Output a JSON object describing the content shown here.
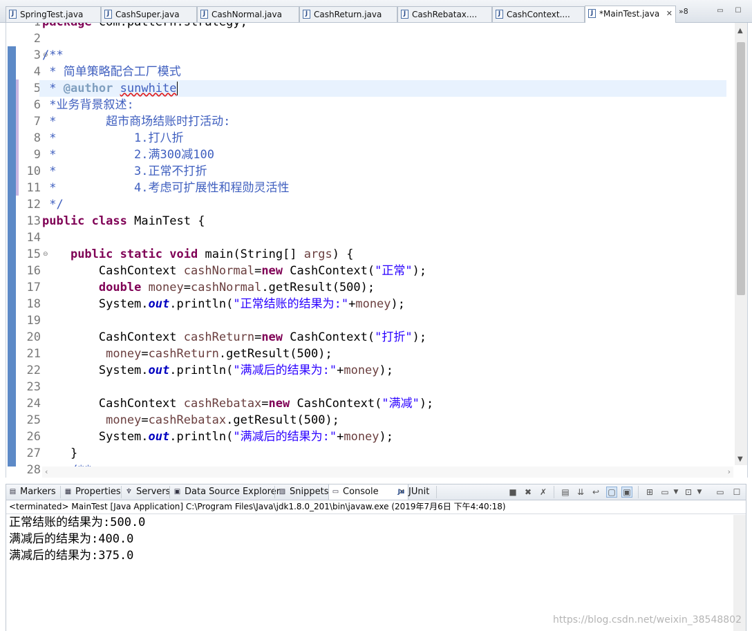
{
  "editor_tabs": [
    {
      "label": "SpringTest.java",
      "active": false
    },
    {
      "label": "CashSuper.java",
      "active": false
    },
    {
      "label": "CashNormal.java",
      "active": false
    },
    {
      "label": "CashReturn.java",
      "active": false
    },
    {
      "label": "CashRebatax....",
      "active": false
    },
    {
      "label": "CashContext....",
      "active": false
    },
    {
      "label": "*MainTest.java",
      "active": true
    }
  ],
  "overflow_tabs": "»8",
  "code_lines": [
    {
      "n": "1",
      "t": "package com.pattern.strategy;"
    },
    {
      "n": "2",
      "t": ""
    },
    {
      "n": "3",
      "t": "/**"
    },
    {
      "n": "4",
      "t": " * 简单策略配合工厂模式"
    },
    {
      "n": "5",
      "t": " * @author sunwhite"
    },
    {
      "n": "6",
      "t": " *业务背景叙述:"
    },
    {
      "n": "7",
      "t": " *       超市商场结账时打活动:"
    },
    {
      "n": "8",
      "t": " *           1.打八折"
    },
    {
      "n": "9",
      "t": " *           2.满300减100"
    },
    {
      "n": "10",
      "t": " *           3.正常不打折"
    },
    {
      "n": "11",
      "t": " *           4.考虑可扩展性和程勋灵活性"
    },
    {
      "n": "12",
      "t": " */"
    },
    {
      "n": "13",
      "t": "public class MainTest {"
    },
    {
      "n": "14",
      "t": ""
    },
    {
      "n": "15",
      "t": "    public static void main(String[] args) {"
    },
    {
      "n": "16",
      "t": "        CashContext cashNormal=new CashContext(\"正常\");"
    },
    {
      "n": "17",
      "t": "        double money=cashNormal.getResult(500);"
    },
    {
      "n": "18",
      "t": "        System.out.println(\"正常结账的结果为:\"+money);"
    },
    {
      "n": "19",
      "t": ""
    },
    {
      "n": "20",
      "t": "        CashContext cashReturn=new CashContext(\"打折\");"
    },
    {
      "n": "21",
      "t": "         money=cashReturn.getResult(500);"
    },
    {
      "n": "22",
      "t": "        System.out.println(\"满减后的结果为:\"+money);"
    },
    {
      "n": "23",
      "t": ""
    },
    {
      "n": "24",
      "t": "        CashContext cashRebatax=new CashContext(\"满减\");"
    },
    {
      "n": "25",
      "t": "         money=cashRebatax.getResult(500);"
    },
    {
      "n": "26",
      "t": "        System.out.println(\"满减后的结果为:\"+money);"
    },
    {
      "n": "27",
      "t": "    }"
    },
    {
      "n": "28",
      "t": "    /**"
    }
  ],
  "view_tabs": [
    {
      "label": "Markers",
      "icon": "markers-icon"
    },
    {
      "label": "Properties",
      "icon": "properties-icon"
    },
    {
      "label": "Servers",
      "icon": "servers-icon"
    },
    {
      "label": "Data Source Explorer",
      "icon": "data-source-icon"
    },
    {
      "label": "Snippets",
      "icon": "snippets-icon"
    },
    {
      "label": "Console",
      "icon": "console-icon",
      "active": true
    },
    {
      "label": "JUnit",
      "icon": "junit-icon"
    }
  ],
  "console": {
    "terminated": "<terminated> MainTest [Java Application] C:\\Program Files\\Java\\jdk1.8.0_201\\bin\\javaw.exe (2019年7月6日 下午4:40:18)",
    "output": [
      "正常结账的结果为:500.0",
      "满减后的结果为:400.0",
      "满减后的结果为:375.0"
    ]
  },
  "watermark": "https://blog.csdn.net/weixin_38548802",
  "colors": {
    "keyword": "#7f0055",
    "comment": "#3f5fbf",
    "string": "#2a00ff",
    "ruler": "#5d8ac7"
  }
}
